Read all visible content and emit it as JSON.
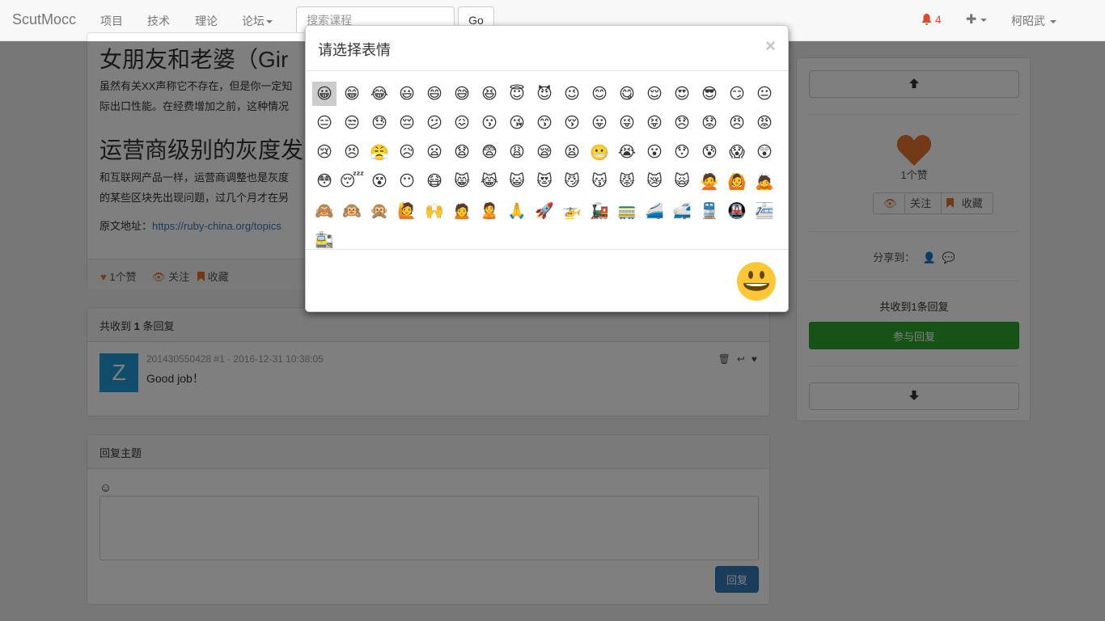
{
  "navbar": {
    "brand": "ScutMocc",
    "links": [
      "项目",
      "技术",
      "理论",
      "论坛"
    ],
    "search_placeholder": "搜索课程",
    "go_label": "Go",
    "notification_count": "4",
    "user_name": "柯昭武",
    "icons": {
      "bell": "bell-icon",
      "plus": "plus-icon"
    }
  },
  "topic": {
    "title": "女朋友和老婆（Gir",
    "para1_line1": "虽然有关XX声称它不存在，但是你一定知",
    "para1_line2": "际出口性能。在经费增加之前，这种情况",
    "heading2": "运营商级别的灰度发",
    "para2_line1": "和互联网产品一样，运营商调整也是灰度",
    "para2_line2": "的某些区块先出现问题，过几个月才在另",
    "source_label": "原文地址：",
    "source_link": "https://ruby-china.org/topics",
    "footer": {
      "likes": "1个赞",
      "follow": "关注",
      "favorite": "收藏"
    }
  },
  "replies": {
    "header_prefix": "共收到 ",
    "header_count": "1",
    "header_suffix": " 条回复",
    "items": [
      {
        "avatar_letter": "Z",
        "meta": "201430550428 #1 · 2016-12-31 10:38:05",
        "body": "Good job！"
      }
    ]
  },
  "compose": {
    "title": "回复主题",
    "emoji_toggle": "☺",
    "submit_label": "回复"
  },
  "sidebar": {
    "like_count": "1个赞",
    "follow": "关注",
    "favorite": "收藏",
    "share_label": "分享到：",
    "reply_count": "共收到1条回复",
    "join_label": "参与回复",
    "up_icon": "arrow-up-icon",
    "down_icon": "arrow-down-icon"
  },
  "modal": {
    "title": "请选择表情",
    "close": "×",
    "selected_index": 0,
    "emojis": [
      "😀",
      "😁",
      "😂",
      "😃",
      "😄",
      "😅",
      "😆",
      "😇",
      "😈",
      "😉",
      "😊",
      "😋",
      "😌",
      "😍",
      "😎",
      "😏",
      "😐",
      "😑",
      "😒",
      "😓",
      "😔",
      "😕",
      "😖",
      "😗",
      "😘",
      "😙",
      "😚",
      "😛",
      "😜",
      "😝",
      "😞",
      "😟",
      "😠",
      "😡",
      "😢",
      "😣",
      "😤",
      "😥",
      "😦",
      "😧",
      "😨",
      "😩",
      "😪",
      "😫",
      "😬",
      "😭",
      "😮",
      "😯",
      "😰",
      "😱",
      "😲",
      "😳",
      "😴",
      "😵",
      "😶",
      "😷",
      "😸",
      "😹",
      "😺",
      "😻",
      "😼",
      "😽",
      "😾",
      "😿",
      "🙀",
      "🙅",
      "🙆",
      "🙇",
      "🙈",
      "🙉",
      "🙊",
      "🙋",
      "🙌",
      "🙍",
      "🙎",
      "🙏",
      "🚀",
      "🚁",
      "🚂",
      "🚃",
      "🚄",
      "🚅",
      "🚆",
      "🚇",
      "🚈",
      "🚉"
    ],
    "preview_icon": "grinning-face-icon"
  },
  "colors": {
    "accent": "#337ab7",
    "danger": "#e2492c",
    "success": "#2ea52e",
    "heart": "#e2722a"
  }
}
